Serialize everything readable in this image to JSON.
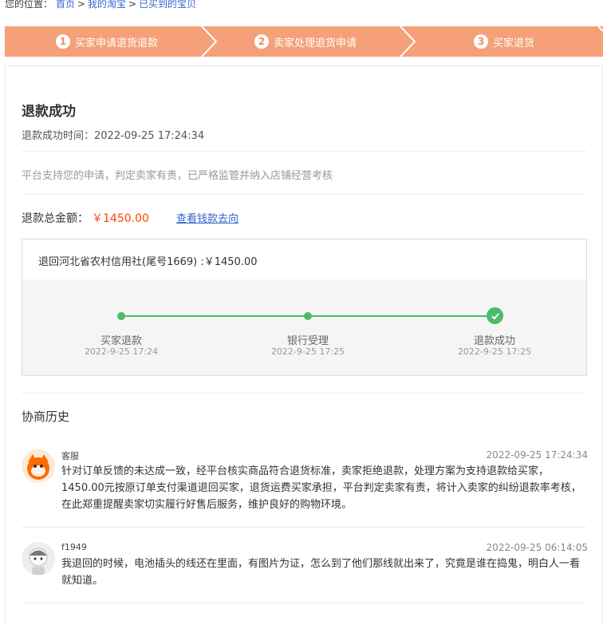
{
  "breadcrumb": {
    "prefix": "您的位置：",
    "items": [
      "首页",
      "我的淘宝",
      "已买到的宝贝"
    ],
    "separator": ">"
  },
  "steps": [
    {
      "num": "1",
      "label": "买家申请退货退款"
    },
    {
      "num": "2",
      "label": "卖家处理退货申请"
    },
    {
      "num": "3",
      "label": "买家退货"
    }
  ],
  "status": {
    "title": "退款成功",
    "time_label": "退款成功时间：",
    "time": "2022-09-25 17:24:34",
    "notice": "平台支持您的申请，判定卖家有责，已严格监管并纳入店铺经营考核",
    "total_label": "退款总金额：",
    "total_amount": "￥1450.00",
    "trace_link": "查看钱款去向"
  },
  "refund_trace": {
    "destination": "退回河北省农村信用社(尾号1669) :￥1450.00",
    "steps": [
      {
        "label": "买家退款",
        "time": "2022-9-25 17:24"
      },
      {
        "label": "银行受理",
        "time": "2022-9-25 17:25"
      },
      {
        "label": "退款成功",
        "time": "2022-9-25 17:25"
      }
    ]
  },
  "history": {
    "title": "协商历史",
    "messages": [
      {
        "name": "客服",
        "time": "2022-09-25 17:24:34",
        "text": "针对订单反馈的未达成一致，经平台核实商品符合退货标准，卖家拒绝退款，处理方案为支持退款给买家，1450.00元按原订单支付渠道退回买家，退货运费买家承担，平台判定卖家有责，将计入卖家的纠纷退款率考核，在此郑重提醒卖家切实履行好售后服务，维护良好的购物环境。"
      },
      {
        "name": "f1949",
        "time": "2022-09-25 06:14:05",
        "text": "我退回的时候，电池插头的线还在里面，有图片为证，怎么到了他们那线就出来了，究竟是谁在捣鬼，明白人一看就知道。"
      }
    ]
  },
  "colors": {
    "step_bar": "#f5a078",
    "link": "#3366cc",
    "amount": "#ff4400",
    "success": "#4cbb6a"
  },
  "icons": {
    "step_complete": "check-circle-icon",
    "service_avatar": "taobao-mascot-avatar",
    "user_avatar": "default-user-avatar"
  }
}
